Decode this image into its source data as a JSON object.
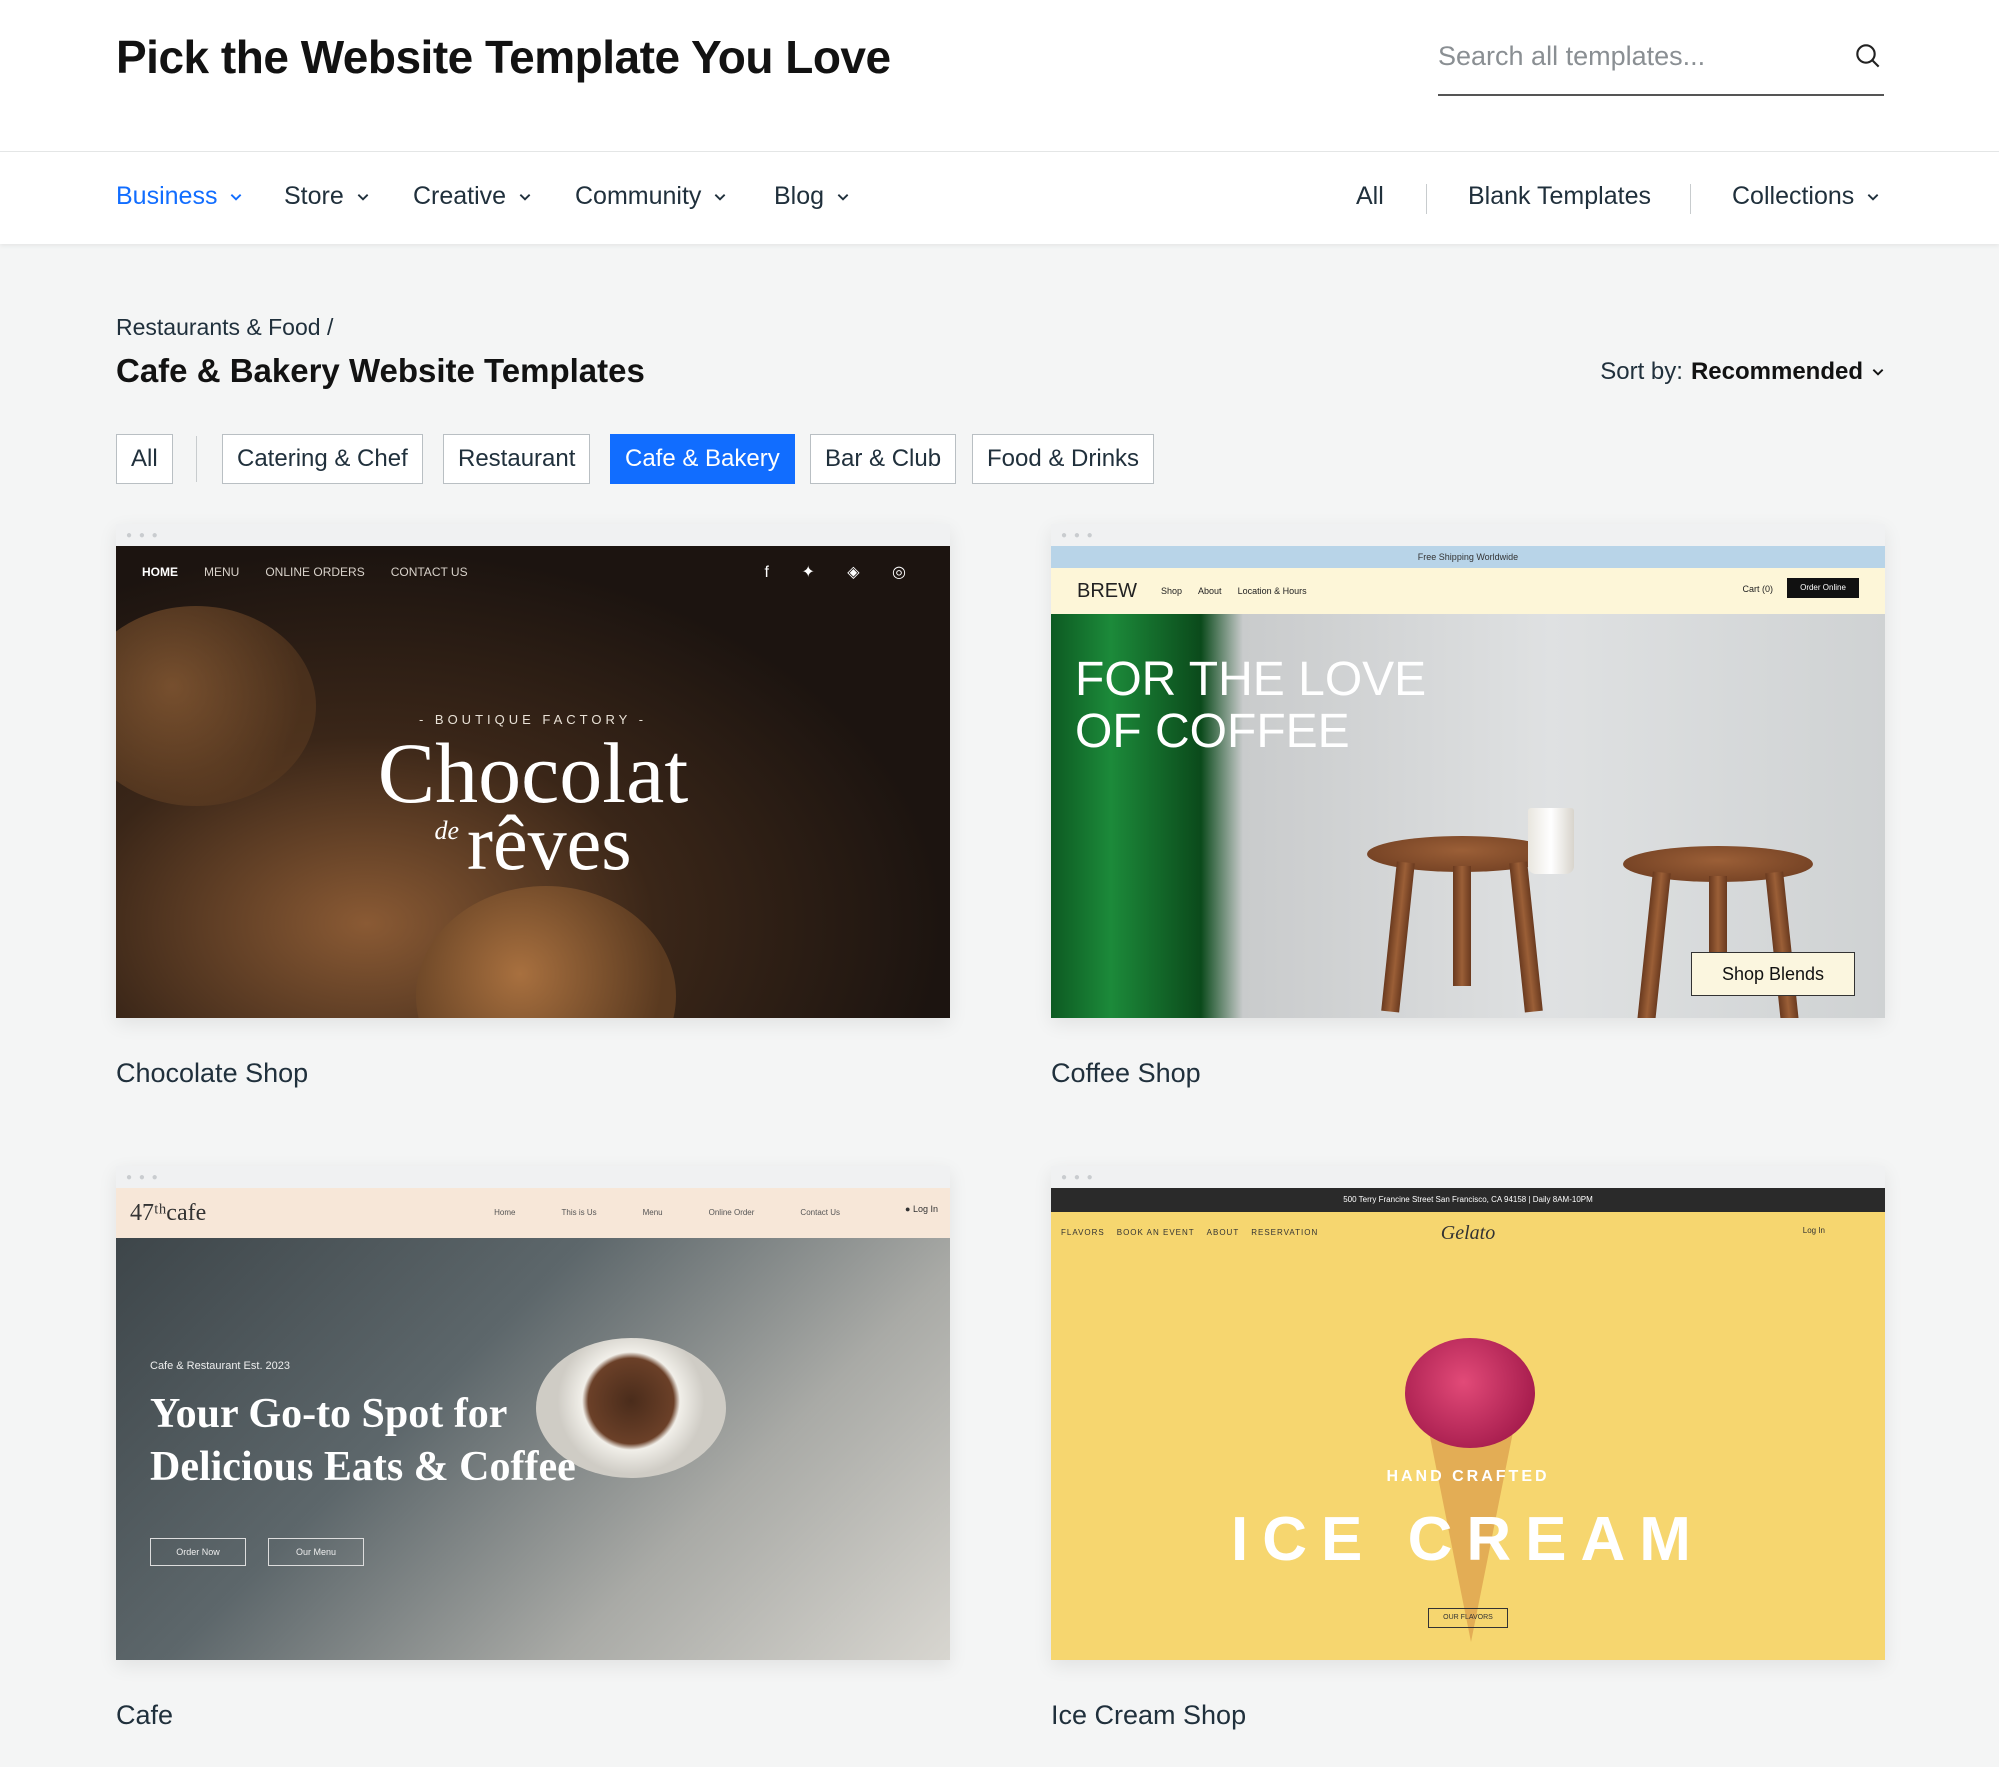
{
  "header": {
    "title": "Pick the Website Template You Love",
    "search_placeholder": "Search all templates..."
  },
  "nav": {
    "left": [
      {
        "label": "Business",
        "active": true
      },
      {
        "label": "Store"
      },
      {
        "label": "Creative"
      },
      {
        "label": "Community"
      },
      {
        "label": "Blog"
      }
    ],
    "right": [
      "All",
      "Blank Templates",
      "Collections"
    ]
  },
  "breadcrumb": "Restaurants & Food /",
  "heading": "Cafe & Bakery Website Templates",
  "sort": {
    "label": "Sort by:",
    "value": "Recommended"
  },
  "filters": [
    "All",
    "Catering & Chef",
    "Restaurant",
    "Cafe & Bakery",
    "Bar & Club",
    "Food & Drinks"
  ],
  "active_filter": "Cafe & Bakery",
  "cards": [
    {
      "name": "Chocolate Shop",
      "preview": {
        "menu": [
          "HOME",
          "MENU",
          "ONLINE ORDERS",
          "CONTACT US"
        ],
        "kicker": "- BOUTIQUE FACTORY -",
        "title_line1": "Chocolat",
        "title_small": "de",
        "title_line2": "rêves"
      }
    },
    {
      "name": "Coffee Shop",
      "preview": {
        "banner": "Free Shipping Worldwide",
        "brand": "BREW",
        "menu": [
          "Shop",
          "About",
          "Location & Hours"
        ],
        "cart": "Cart (0)",
        "order": "Order Online",
        "headline_1": "FOR THE LOVE",
        "headline_2": "OF COFFEE",
        "cta": "Shop Blends"
      }
    },
    {
      "name": "Cafe",
      "preview": {
        "logo": "47ᵗʰcafe",
        "menu": [
          "Home",
          "This is Us",
          "Menu",
          "Online Order",
          "Contact Us"
        ],
        "login": "Log In",
        "est": "Cafe & Restaurant Est. 2023",
        "headline_1": "Your Go-to Spot for",
        "headline_2": "Delicious Eats & Coffee",
        "btn1": "Order Now",
        "btn2": "Our Menu"
      }
    },
    {
      "name": "Ice Cream Shop",
      "preview": {
        "topbar": "500 Terry Francine Street San Francisco, CA 94158 | Daily 8AM-10PM",
        "menu": [
          "FLAVORS",
          "BOOK AN EVENT",
          "ABOUT",
          "RESERVATION"
        ],
        "brand": "Gelato",
        "login": "Log In",
        "kicker": "HAND CRAFTED",
        "headline": "ICE CREAM",
        "cta": "OUR FLAVORS"
      }
    }
  ],
  "colors": {
    "accent": "#116dff",
    "text": "#20303c",
    "background": "#f4f5f5"
  }
}
